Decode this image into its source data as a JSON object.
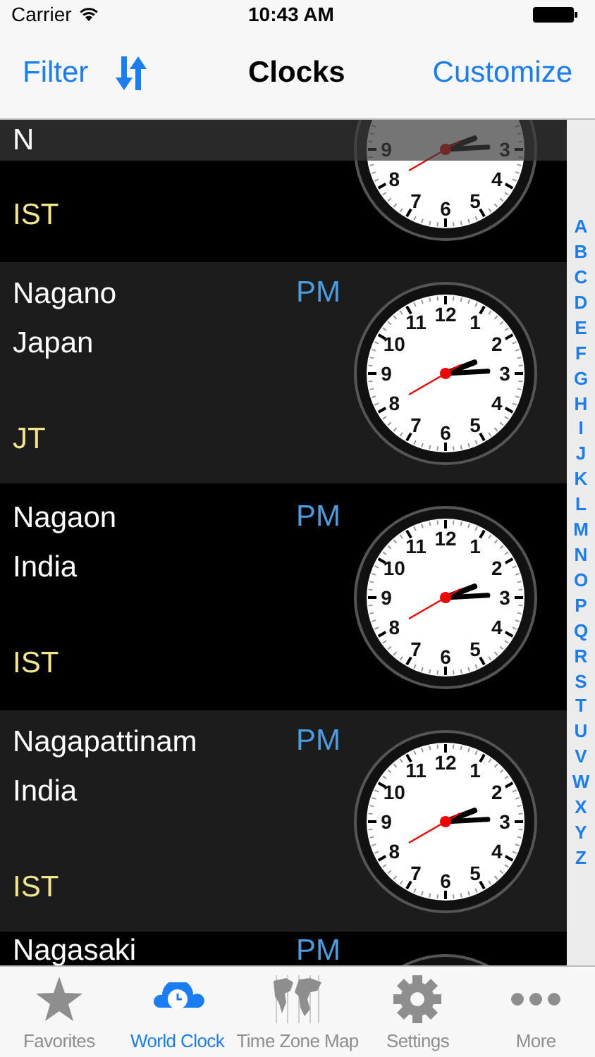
{
  "status_bar": {
    "carrier": "Carrier",
    "time": "10:43 AM"
  },
  "nav": {
    "left": "Filter",
    "title": "Clocks",
    "right": "Customize"
  },
  "section_header": "N",
  "rows": [
    {
      "zone": "IST",
      "dial": [
        "9",
        "3",
        "8",
        "4",
        "7",
        "6",
        "5"
      ]
    },
    {
      "name": "Nagano",
      "country": "Japan",
      "ampm": "PM",
      "zone": "JT",
      "dial": [
        "11",
        "12",
        "1",
        "10",
        "2",
        "9",
        "3",
        "8",
        "4",
        "7",
        "6",
        "5"
      ]
    },
    {
      "name": "Nagaon",
      "country": "India",
      "ampm": "PM",
      "zone": "IST",
      "dial": [
        "11",
        "12",
        "1",
        "10",
        "2",
        "9",
        "3",
        "8",
        "4",
        "7",
        "6",
        "5"
      ]
    },
    {
      "name": "Nagapattinam",
      "country": "India",
      "ampm": "PM",
      "zone": "IST",
      "dial": [
        "11",
        "12",
        "1",
        "10",
        "2",
        "9",
        "3",
        "8",
        "4",
        "7",
        "6",
        "5"
      ]
    },
    {
      "name": "Nagasaki",
      "ampm": "PM"
    }
  ],
  "index": [
    "A",
    "B",
    "C",
    "D",
    "E",
    "F",
    "G",
    "H",
    "I",
    "J",
    "K",
    "L",
    "M",
    "N",
    "O",
    "P",
    "Q",
    "R",
    "S",
    "T",
    "U",
    "V",
    "W",
    "X",
    "Y",
    "Z"
  ],
  "tabs": [
    {
      "label": "Favorites",
      "kind": "star",
      "selected": false
    },
    {
      "label": "World Clock",
      "kind": "clock",
      "selected": true
    },
    {
      "label": "Time Zone Map",
      "kind": "map",
      "selected": false
    },
    {
      "label": "Settings",
      "kind": "gear",
      "selected": false
    },
    {
      "label": "More",
      "kind": "dots",
      "selected": false
    }
  ]
}
